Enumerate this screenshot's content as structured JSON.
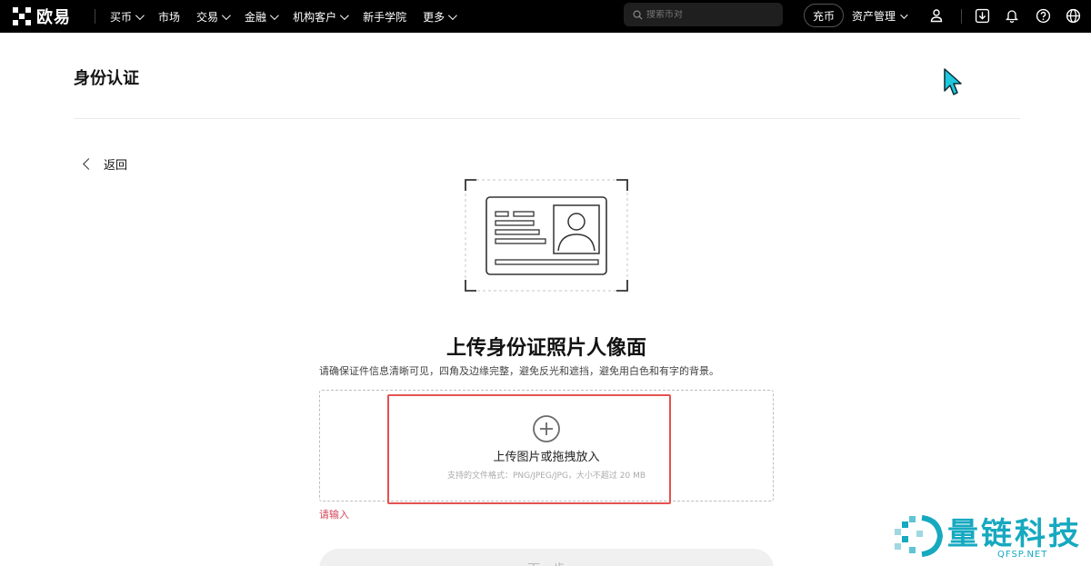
{
  "topbar": {
    "logo_text": "欧易",
    "nav": [
      {
        "label": "买币",
        "dropdown": true
      },
      {
        "label": "市场",
        "dropdown": false
      },
      {
        "label": "交易",
        "dropdown": true
      },
      {
        "label": "金融",
        "dropdown": true
      },
      {
        "label": "机构客户",
        "dropdown": true
      },
      {
        "label": "新手学院",
        "dropdown": false
      },
      {
        "label": "更多",
        "dropdown": true
      }
    ],
    "search_placeholder": "搜索币对",
    "deposit_label": "充币",
    "asset_label": "资产管理",
    "icons": [
      "user-icon",
      "download-icon",
      "bell-icon",
      "help-icon",
      "globe-icon"
    ]
  },
  "page": {
    "title": "身份认证",
    "back_label": "返回",
    "upload_title": "上传身份证照片人像面",
    "upload_desc": "请确保证件信息清晰可见，四角及边缘完整，避免反光和遮挡，避免用白色和有字的背景。",
    "dropzone_label": "上传图片或拖拽放入",
    "dropzone_hint": "支持的文件格式：PNG/JPEG/JPG，大小不超过 20 MB",
    "error_text": "请输入",
    "next_label": "下一步"
  },
  "watermark": {
    "text": "量链科技",
    "sub": "QFSP.NET"
  },
  "colors": {
    "topbar_bg": "#000000",
    "highlight_border": "#e4524f",
    "error": "#d5475b",
    "watermark": "#16a9c0"
  }
}
